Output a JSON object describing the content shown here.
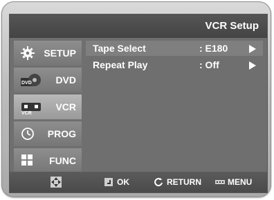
{
  "title": "VCR Setup",
  "sidebar": {
    "items": [
      {
        "label": "SETUP",
        "icon": "gear-icon"
      },
      {
        "label": "DVD",
        "icon": "dvd-icon"
      },
      {
        "label": "VCR",
        "icon": "vcr-icon",
        "selected": true
      },
      {
        "label": "PROG",
        "icon": "clock-icon"
      },
      {
        "label": "FUNC",
        "icon": "grid-icon"
      }
    ]
  },
  "main": {
    "rows": [
      {
        "key": "Tape Select",
        "value": ": E180",
        "highlight": true
      },
      {
        "key": "Repeat Play",
        "value": ": Off",
        "highlight": false
      }
    ]
  },
  "bottom": {
    "nav_icon": "dpad-icon",
    "ok_label": "OK",
    "return_label": "RETURN",
    "menu_label": "MENU"
  }
}
